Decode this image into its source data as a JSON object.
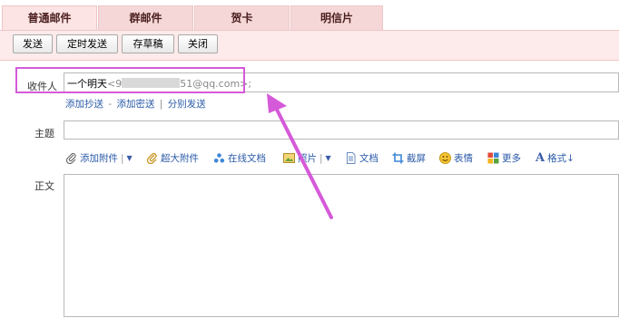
{
  "tabs": [
    {
      "label": "普通邮件",
      "active": true
    },
    {
      "label": "群邮件",
      "active": false
    },
    {
      "label": "贺卡",
      "active": false
    },
    {
      "label": "明信片",
      "active": false
    }
  ],
  "toolbar": {
    "send": "发送",
    "scheduled_send": "定时发送",
    "save_draft": "存草稿",
    "close": "关闭"
  },
  "compose": {
    "to_label": "收件人",
    "to_name": "一个明天",
    "to_addr_start": "<9",
    "to_addr_end": "51@qq.com>;",
    "add_cc": "添加抄送",
    "link_separator": "-",
    "add_bcc": "添加密送",
    "bar": "|",
    "separate_send": "分别发送",
    "subject_label": "主题",
    "body_label": "正文"
  },
  "attach_bar": {
    "add_attachment": "添加附件",
    "large_attachment": "超大附件",
    "online_doc": "在线文档",
    "photo": "照片",
    "doc": "文档",
    "screenshot": "截屏",
    "emoji": "表情",
    "more": "更多",
    "format": "格式"
  },
  "colors": {
    "tab_bg": "#f6d7d7",
    "panel_bg": "#fdeaea",
    "link": "#2a5aa8",
    "highlight": "#d55ad9"
  }
}
